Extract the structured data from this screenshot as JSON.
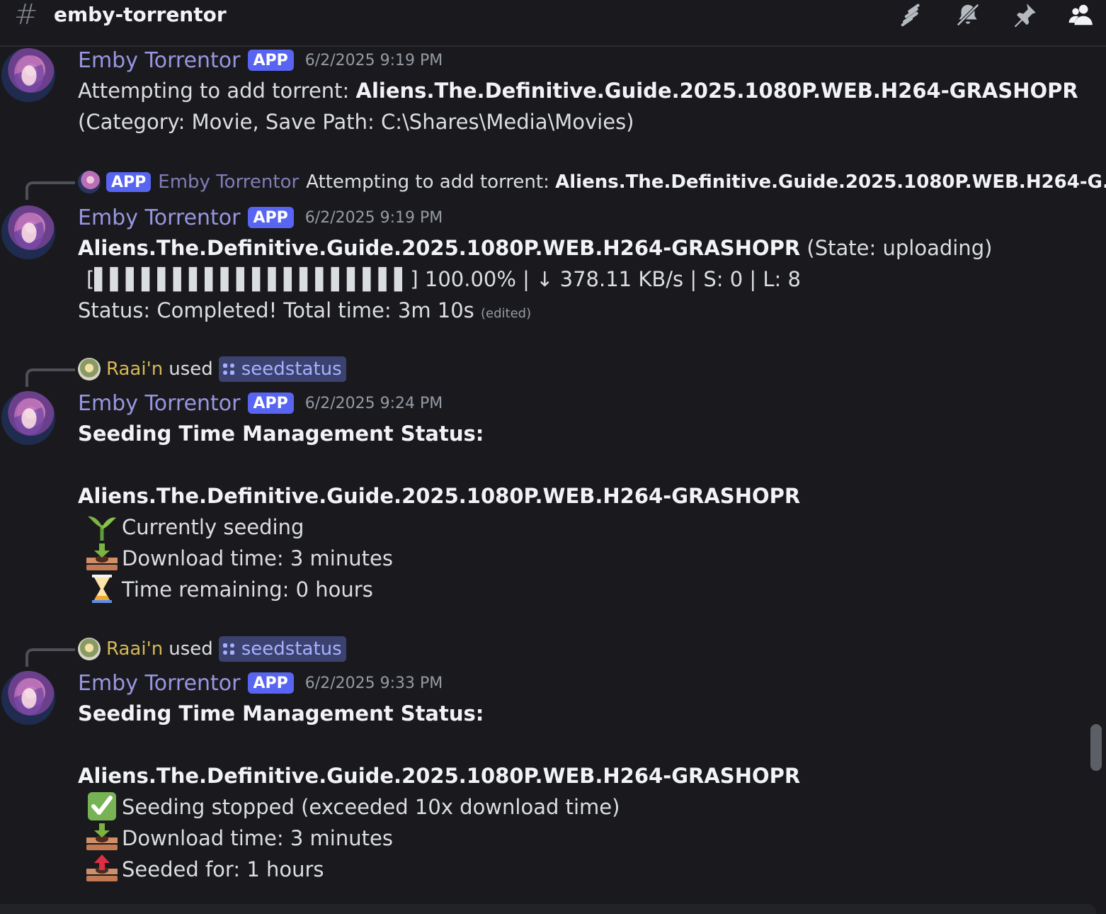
{
  "channel": {
    "name": "emby-torrentor",
    "icon": "hash-threads-icon"
  },
  "toolbar": {
    "icons": [
      "threads-icon",
      "bell-muted-icon",
      "pin-icon",
      "members-icon"
    ]
  },
  "bot": {
    "name": "Emby Torrentor",
    "badge": "APP"
  },
  "messages": [
    {
      "timestamp": "6/2/2025 9:19 PM",
      "line1_prefix": "Attempting to add torrent: ",
      "line1_bold": "Aliens.The.Definitive.Guide.2025.1080P.WEB.H264-GRASHOPR",
      "line2": "(Category: Movie, Save Path: C:\\Shares\\Media\\Movies)"
    },
    {
      "reply": {
        "badge": "APP",
        "author": "Emby Torrentor",
        "text_prefix": "Attempting to add torrent: ",
        "text_bold": "Aliens.The.Definitive.Guide.2025.1080P.WEB.H264-G..."
      },
      "timestamp": "6/2/2025 9:19 PM",
      "line1_bold": "Aliens.The.Definitive.Guide.2025.1080P.WEB.H264-GRASHOPR",
      "line1_suffix": " (State: uploading)",
      "progress_line": "[▌▌▌▌▌▌▌▌▌▌▌▌▌▌▌▌▌▌▌▌] 100.00% | ↓ 378.11 KB/s | S: 0 | L: 8",
      "progress": 1.0,
      "status_line": "Status: Completed! Total time: 3m 10s",
      "edited": "(edited)"
    },
    {
      "command": {
        "user": "Raai'n",
        "used": "used",
        "command": "seedstatus"
      },
      "timestamp": "6/2/2025 9:24 PM",
      "title": "Seeding Time Management Status:",
      "torrent": "Aliens.The.Definitive.Guide.2025.1080P.WEB.H264-GRASHOPR",
      "items": [
        {
          "icon": "seedling-icon",
          "text": "Currently seeding"
        },
        {
          "icon": "download-tray-icon",
          "text": "Download time: 3 minutes"
        },
        {
          "icon": "hourglass-icon",
          "text": "Time remaining: 0 hours"
        }
      ]
    },
    {
      "command": {
        "user": "Raai'n",
        "used": "used",
        "command": "seedstatus"
      },
      "timestamp": "6/2/2025 9:33 PM",
      "title": "Seeding Time Management Status:",
      "torrent": "Aliens.The.Definitive.Guide.2025.1080P.WEB.H264-GRASHOPR",
      "items": [
        {
          "icon": "check-mark-icon",
          "text": "Seeding stopped (exceeded 10x download time)"
        },
        {
          "icon": "download-tray-icon",
          "text": "Download time: 3 minutes"
        },
        {
          "icon": "upload-tray-icon",
          "text": "Seeded for: 1 hours"
        }
      ]
    }
  ]
}
